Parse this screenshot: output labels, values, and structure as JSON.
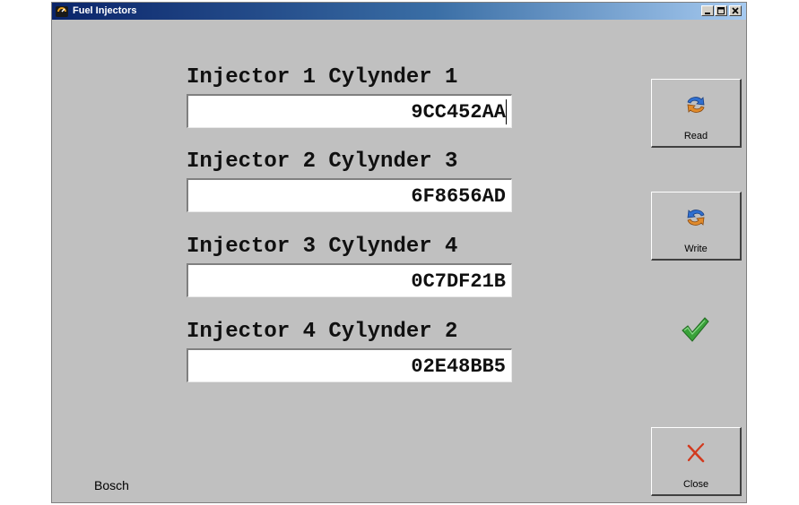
{
  "window": {
    "title": "Fuel Injectors",
    "app_icon": "app-logo-icon",
    "controls": [
      "minimize-icon",
      "maximize-icon",
      "close-icon"
    ]
  },
  "injectors": [
    {
      "label": "Injector 1 Cylynder 1",
      "code": "9CC452AA"
    },
    {
      "label": "Injector 2 Cylynder 3",
      "code": "6F8656AD"
    },
    {
      "label": "Injector 3 Cylynder 4",
      "code": "0C7DF21B"
    },
    {
      "label": "Injector 4 Cylynder 2",
      "code": "02E48BB5"
    }
  ],
  "buttons": {
    "read": {
      "label": "Read",
      "icon": "read-arrows-icon"
    },
    "write": {
      "label": "Write",
      "icon": "write-arrows-icon"
    },
    "close": {
      "label": "Close",
      "icon": "red-x-icon"
    }
  },
  "status_icon": "green-check-icon",
  "manufacturer": "Bosch",
  "colors": {
    "window_bg": "#c0c0c0",
    "titlebar_start": "#0a246a",
    "titlebar_end": "#a6caf0",
    "check": "#3aa23a",
    "close_x": "#d23a1e"
  }
}
